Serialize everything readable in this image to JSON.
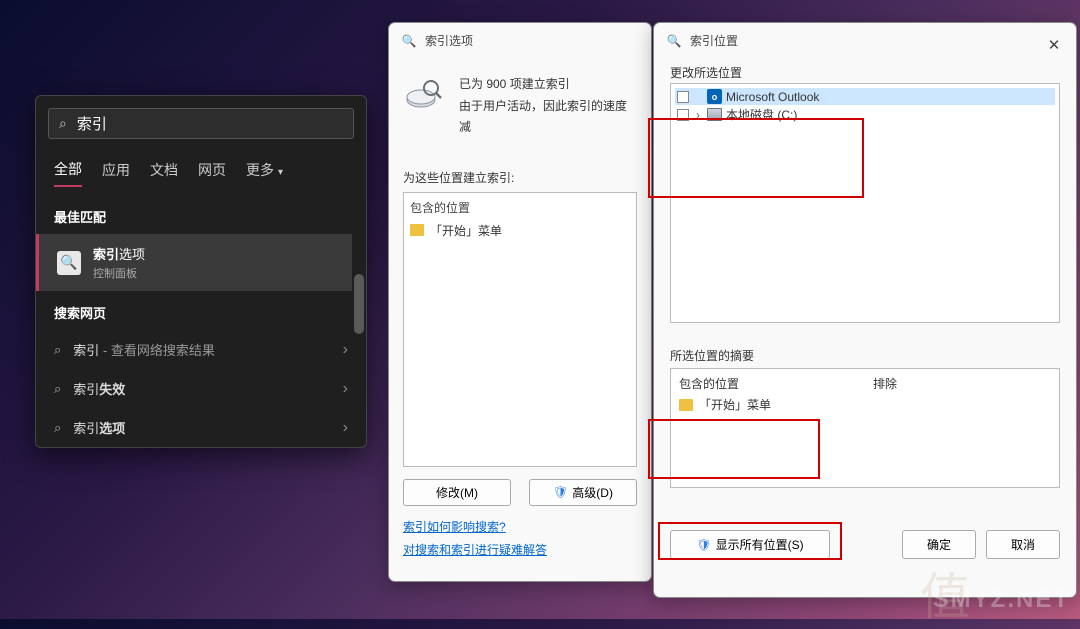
{
  "search": {
    "value": "索引",
    "tabs": [
      "全部",
      "应用",
      "文档",
      "网页",
      "更多"
    ],
    "best_match_header": "最佳匹配",
    "best_match": {
      "title_prefix": "索引",
      "title_suffix": "选项",
      "subtitle": "控制面板"
    },
    "web_header": "搜索网页",
    "web_items": [
      {
        "prefix": "索引",
        "suffix": " - 查看网络搜索结果",
        "suffix_bold": false
      },
      {
        "prefix": "索引",
        "suffix": "失效",
        "suffix_bold": true
      },
      {
        "prefix": "索引",
        "suffix": "选项",
        "suffix_bold": true
      }
    ]
  },
  "index_options": {
    "title": "索引选项",
    "status1": "已为 900 项建立索引",
    "status2": "由于用户活动，因此索引的速度减",
    "list_label": "为这些位置建立索引:",
    "col_header": "包含的位置",
    "entry": "「开始」菜单",
    "modify_btn": "修改(M)",
    "advanced_btn": "高级(D)",
    "link1": "索引如何影响搜索?",
    "link2": "对搜索和索引进行疑难解答"
  },
  "index_location": {
    "title": "索引位置",
    "change_label": "更改所选位置",
    "tree": [
      {
        "name": "Microsoft Outlook",
        "type": "outlook",
        "selected": true
      },
      {
        "name": "本地磁盘 (C:)",
        "type": "disk",
        "expandable": true
      }
    ],
    "summary_label": "所选位置的摘要",
    "included_header": "包含的位置",
    "included_entry": "「开始」菜单",
    "exclude_header": "排除",
    "show_all_btn": "显示所有位置(S)",
    "ok_btn": "确定",
    "cancel_btn": "取消"
  },
  "watermark": "SMYZ.NET"
}
